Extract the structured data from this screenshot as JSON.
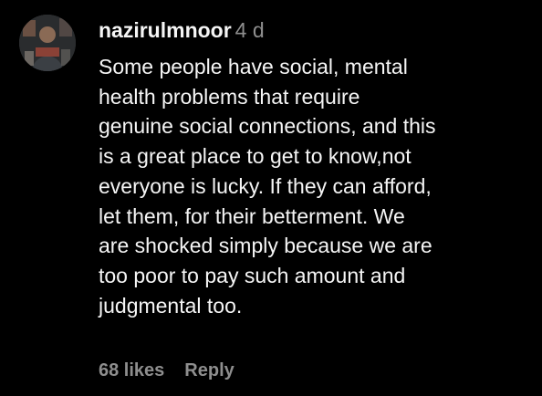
{
  "comment": {
    "username": "nazirulmnoor",
    "time": "4 d",
    "text_lines": [
      "Some people have social, mental",
      "health problems that require",
      "genuine social connections, and this",
      "is a great place to get to know,not",
      "everyone is lucky. If they can afford,",
      "let them, for their betterment. We",
      "are shocked simply because we are",
      "too poor to pay such amount and",
      "judgmental too."
    ],
    "likes": "68 likes",
    "reply": "Reply"
  },
  "colors": {
    "background": "#000000",
    "text": "#f5f5f5",
    "secondary": "#8e8e8e"
  },
  "icons": {
    "avatar": "user-avatar"
  }
}
